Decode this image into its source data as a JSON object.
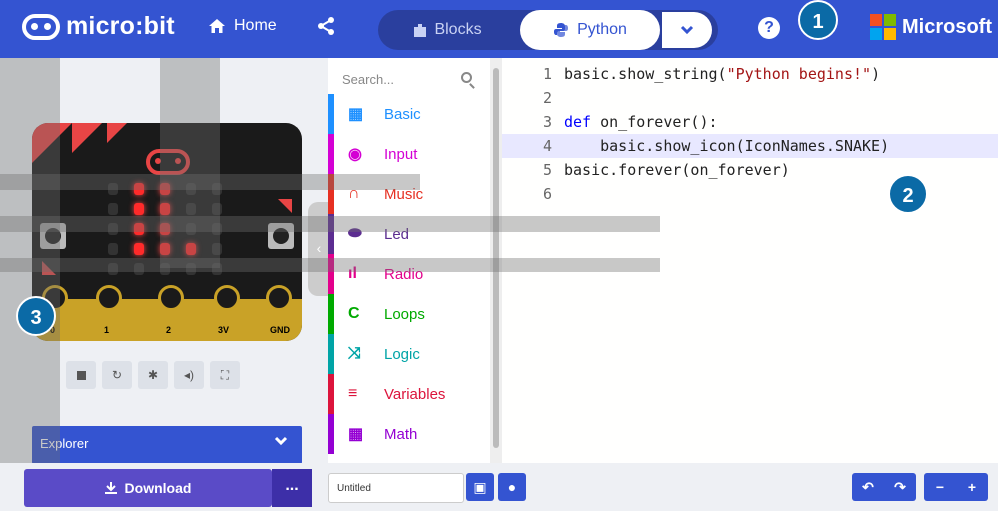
{
  "header": {
    "logo_text": "micro:bit",
    "home_label": "Home",
    "blocks_label": "Blocks",
    "python_label": "Python",
    "brand_label": "Microsoft"
  },
  "toolbox": {
    "search_placeholder": "Search...",
    "categories": [
      {
        "label": "Basic",
        "icon": "grid-icon",
        "color": "#1e90ff"
      },
      {
        "label": "Input",
        "icon": "target-icon",
        "color": "#d400d4"
      },
      {
        "label": "Music",
        "icon": "headphones-icon",
        "color": "#e63022"
      },
      {
        "label": "Led",
        "icon": "toggle-icon",
        "color": "#5c2d91"
      },
      {
        "label": "Radio",
        "icon": "signal-icon",
        "color": "#e3008c"
      },
      {
        "label": "Loops",
        "icon": "loop-icon",
        "color": "#00aa00"
      },
      {
        "label": "Logic",
        "icon": "shuffle-icon",
        "color": "#00a4a6"
      },
      {
        "label": "Variables",
        "icon": "lines-icon",
        "color": "#dc143c"
      },
      {
        "label": "Math",
        "icon": "calculator-icon",
        "color": "#9400d3"
      }
    ]
  },
  "editor": {
    "lines": [
      {
        "n": "1",
        "text": "basic.show_string(\"Python begins!\")"
      },
      {
        "n": "2",
        "text": ""
      },
      {
        "n": "3",
        "text": "def on_forever():"
      },
      {
        "n": "4",
        "text": "    basic.show_icon(IconNames.SNAKE)"
      },
      {
        "n": "5",
        "text": "basic.forever(on_forever)"
      },
      {
        "n": "6",
        "text": ""
      }
    ]
  },
  "simulator": {
    "pins": [
      "0",
      "1",
      "2",
      "3V",
      "GND"
    ],
    "led_on": [
      [
        0,
        1,
        1,
        0,
        0
      ],
      [
        0,
        1,
        1,
        0,
        0
      ],
      [
        0,
        1,
        1,
        0,
        0
      ],
      [
        0,
        1,
        1,
        1,
        0
      ],
      [
        0,
        0,
        0,
        0,
        0
      ]
    ]
  },
  "explorer_label": "Explorer",
  "download_label": "Download",
  "more_label": "...",
  "filename_value": "Untitled",
  "badges": [
    "1",
    "2",
    "3"
  ]
}
